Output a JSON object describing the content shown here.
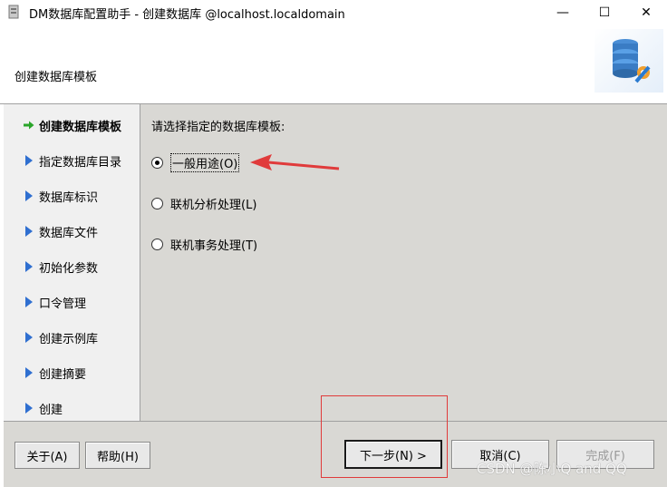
{
  "window": {
    "title": "DM数据库配置助手 - 创建数据库 @localhost.localdomain",
    "controls": {
      "minimize": "—",
      "maximize": "☐",
      "close": "✕"
    }
  },
  "header": {
    "title": "创建数据库模板",
    "logo_icon": "database-gear-icon"
  },
  "sidebar": {
    "items": [
      {
        "label": "创建数据库模板",
        "icon": "green-arrow-icon",
        "active": true
      },
      {
        "label": "指定数据库目录",
        "icon": "blue-triangle-icon",
        "active": false
      },
      {
        "label": "数据库标识",
        "icon": "blue-triangle-icon",
        "active": false
      },
      {
        "label": "数据库文件",
        "icon": "blue-triangle-icon",
        "active": false
      },
      {
        "label": "初始化参数",
        "icon": "blue-triangle-icon",
        "active": false
      },
      {
        "label": "口令管理",
        "icon": "blue-triangle-icon",
        "active": false
      },
      {
        "label": "创建示例库",
        "icon": "blue-triangle-icon",
        "active": false
      },
      {
        "label": "创建摘要",
        "icon": "blue-triangle-icon",
        "active": false
      },
      {
        "label": "创建",
        "icon": "blue-triangle-icon",
        "active": false
      }
    ]
  },
  "main": {
    "prompt": "请选择指定的数据库模板:",
    "options": [
      {
        "label": "一般用途(O)",
        "checked": true
      },
      {
        "label": "联机分析处理(L)",
        "checked": false
      },
      {
        "label": "联机事务处理(T)",
        "checked": false
      }
    ]
  },
  "buttons": {
    "about": "关于(A)",
    "help": "帮助(H)",
    "next": "下一步(N) >",
    "cancel": "取消(C)",
    "finish": "完成(F)"
  },
  "watermark": "CSDN @陈小Q and QQ",
  "colors": {
    "accent_red": "#e03b3b",
    "panel_bg": "#d9d8d4",
    "nav_arrow_blue": "#2f6fd0",
    "nav_arrow_green": "#2aa52a"
  }
}
